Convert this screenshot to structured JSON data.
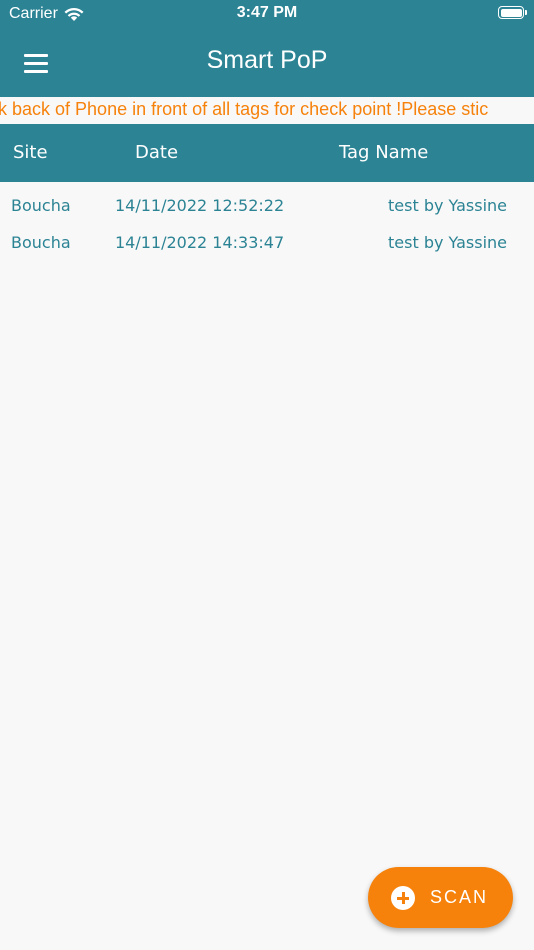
{
  "status_bar": {
    "carrier": "Carrier",
    "time": "3:47 PM",
    "battery_level": 1.0
  },
  "app_bar": {
    "title": "Smart PoP",
    "menu_icon": "hamburger-menu-icon"
  },
  "marquee": {
    "text": "ck back of Phone in front of all tags for check point !Please stic"
  },
  "table": {
    "headers": [
      "Site",
      "Date",
      "Tag Name"
    ],
    "rows": [
      [
        "Boucha",
        "14/11/2022 12:52:22",
        "test by Yassine"
      ],
      [
        "Boucha",
        "14/11/2022 14:33:47",
        "test by Yassine"
      ]
    ]
  },
  "fab": {
    "label": "SCAN",
    "icon": "plus-circle-icon"
  },
  "colors": {
    "primary": "#2b8394",
    "accent": "#f6820c",
    "background": "#f8f8f8"
  }
}
